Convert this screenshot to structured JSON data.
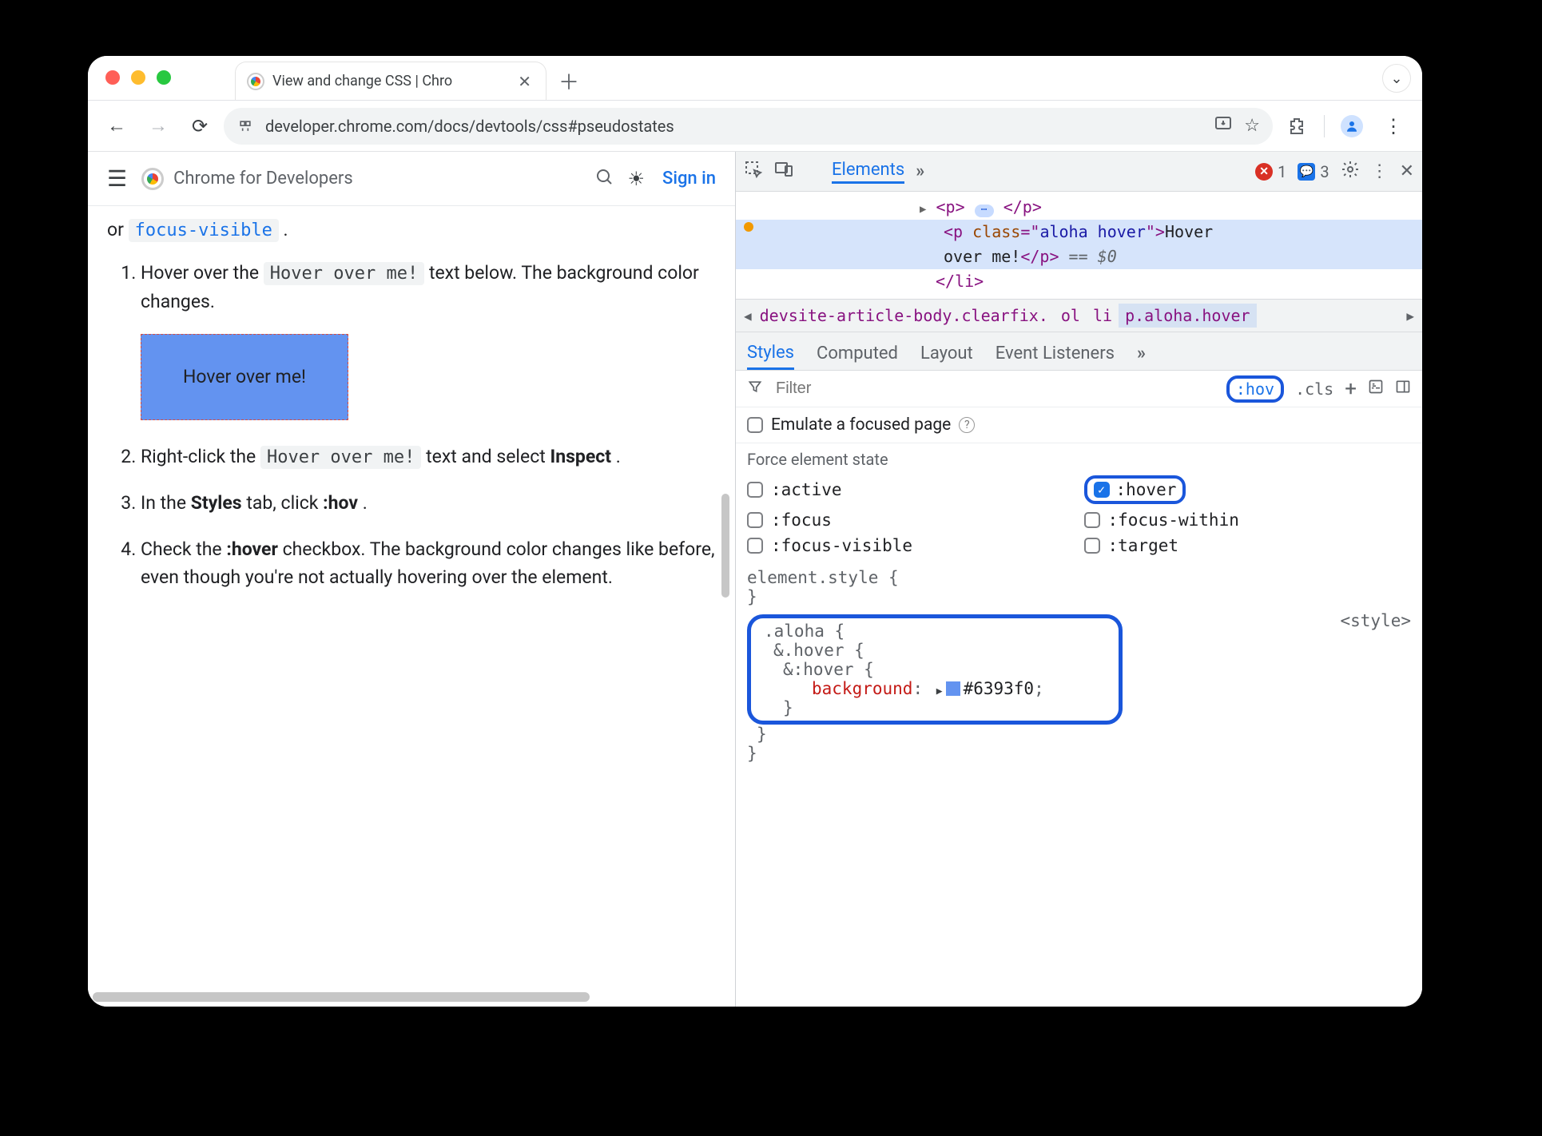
{
  "browser": {
    "tab_title": "View and change CSS  |  Chro",
    "url": "developer.chrome.com/docs/devtools/css#pseudostates"
  },
  "page": {
    "brand": "Chrome for Developers",
    "sign_in": "Sign in",
    "intro_fragment_or": "or ",
    "intro_fragment_code": "focus-visible",
    "intro_fragment_dot": " .",
    "step1a": "Hover over the ",
    "step1code": "Hover over me!",
    "step1b": " text below. The background color changes.",
    "hover_box": "Hover over me!",
    "step2a": "Right-click the ",
    "step2code": "Hover over me!",
    "step2b": " text and select ",
    "step2inspect": "Inspect",
    "step2dot": ".",
    "step3a": "In the ",
    "step3styles": "Styles",
    "step3b": " tab, click ",
    "step3hov": ":hov",
    "step3dot": ".",
    "step4a": "Check the ",
    "step4hover": ":hover",
    "step4b": " checkbox. The background color changes like before, even though you're not actually hovering over the element."
  },
  "devtools": {
    "elements_label": "Elements",
    "errors": "1",
    "messages": "3",
    "dom": {
      "l1": {
        "open": "<p>",
        "close": "</p>",
        "ell": "⋯"
      },
      "l2": {
        "open": "<p ",
        "attr": "class",
        "eq": "=\"",
        "val": "aloha hover",
        "close": "\">",
        "text": "Hover "
      },
      "l3": {
        "text": "over me!",
        "close": "</p>",
        "eq": " == ",
        "ref": "$0"
      },
      "l4": {
        "close": "</li>"
      }
    },
    "crumb": {
      "c1": "devsite-article-body.clearfix.",
      "c2": "ol",
      "c3": "li",
      "c4": "p.aloha.hover"
    },
    "styles_tab": "Styles",
    "computed_tab": "Computed",
    "layout_tab": "Layout",
    "events_tab": "Event Listeners",
    "filter_placeholder": "Filter",
    "hov_chip": ":hov",
    "cls_chip": ".cls",
    "emf_label": "Emulate a focused page",
    "force_label": "Force element state",
    "states": {
      "active": ":active",
      "hover": ":hover",
      "focus": ":focus",
      "focus_within": ":focus-within",
      "focus_visible": ":focus-visible",
      "target": ":target"
    },
    "rule_src": "<style>",
    "element_style": "element.style {",
    "element_style_close": "}",
    "rule": {
      "l1": ".aloha {",
      "l2": "&.hover {",
      "l3": "&:hover {",
      "prop": "background",
      "val": "#6393f0",
      "end": ";",
      "c1": "}",
      "c2": "}",
      "c3": "}"
    }
  }
}
